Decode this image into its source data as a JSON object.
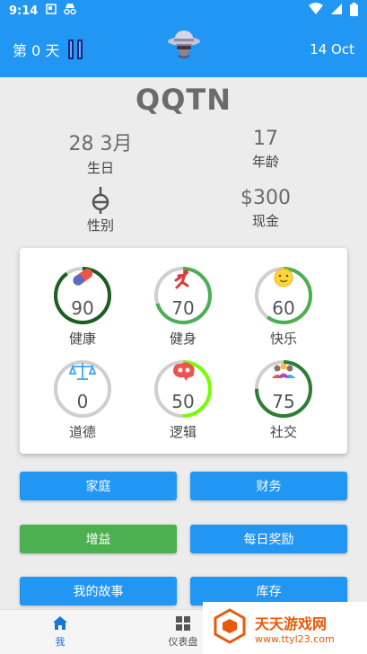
{
  "status": {
    "time": "9:14"
  },
  "header": {
    "day_label": "第 0 天",
    "date": "14 Oct"
  },
  "profile": {
    "name": "QQTN",
    "birthday_value": "28 3月",
    "birthday_label": "生日",
    "age_value": "17",
    "age_label": "年龄",
    "gender_label": "性别",
    "cash_value": "$300",
    "cash_label": "现金"
  },
  "stats": [
    {
      "label": "健康",
      "value": "90",
      "level": 0.9,
      "color": "#1b5e20",
      "icon": "pill-icon"
    },
    {
      "label": "健身",
      "value": "70",
      "level": 0.7,
      "color": "#4caf50",
      "icon": "running-icon"
    },
    {
      "label": "快乐",
      "value": "60",
      "level": 0.6,
      "color": "#4caf50",
      "icon": "smiley-icon"
    },
    {
      "label": "道德",
      "value": "0",
      "level": 0.0,
      "color": "#bdbdbd",
      "icon": "scales-icon"
    },
    {
      "label": "逻辑",
      "value": "50",
      "level": 0.5,
      "color": "#76ff03",
      "icon": "brain-icon"
    },
    {
      "label": "社交",
      "value": "75",
      "level": 0.75,
      "color": "#2e7d32",
      "icon": "people-icon"
    }
  ],
  "buttons": {
    "family": "家庭",
    "finance": "财务",
    "boost": "增益",
    "daily_reward": "每日奖励",
    "my_story": "我的故事",
    "inventory": "库存"
  },
  "nav": {
    "me": "我",
    "dashboard": "仪表盘"
  },
  "watermark": {
    "title": "天天游戏网",
    "url": "www.ttyl23.com"
  }
}
